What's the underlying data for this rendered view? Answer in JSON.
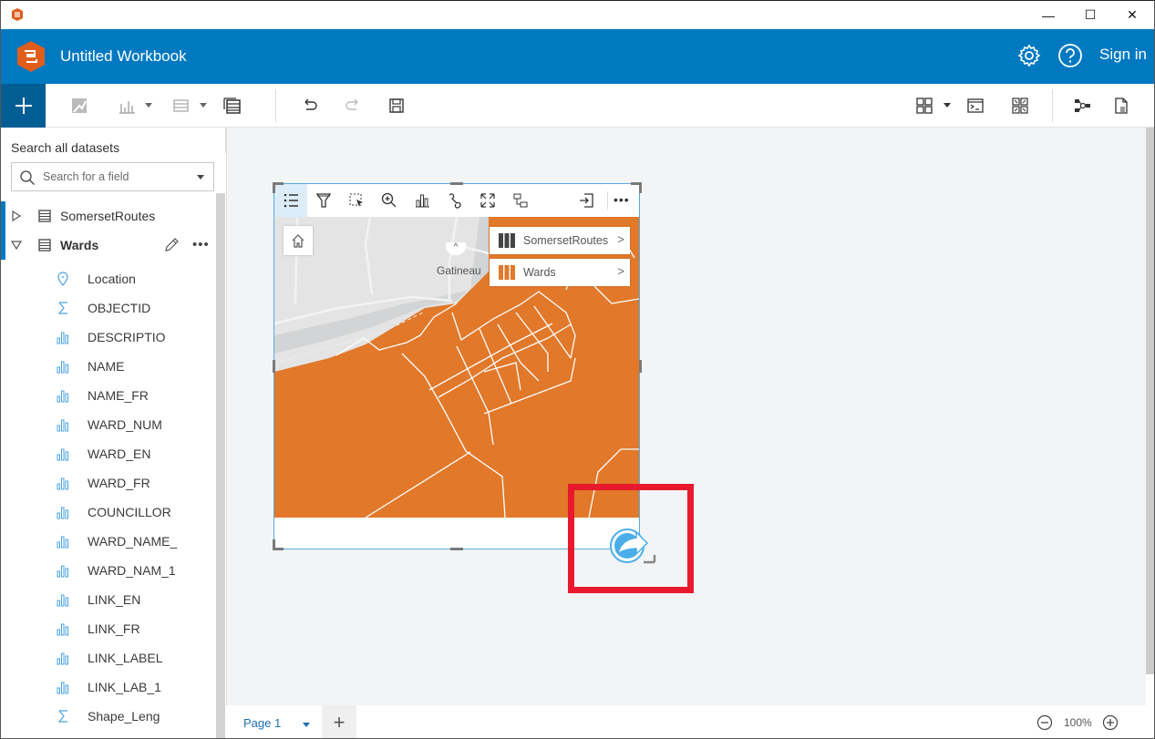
{
  "window": {
    "controls": {
      "minimize": "—",
      "maximize": "☐",
      "close": "✕"
    }
  },
  "header": {
    "title": "Untitled Workbook",
    "sign_in": "Sign in",
    "brand_color": "#0079c1",
    "icons": [
      "app-logo-icon",
      "gear-icon",
      "help-icon"
    ]
  },
  "toolbar": {
    "add_label": "+",
    "icons": [
      "map-icon",
      "chart-icon",
      "table-icon",
      "data-table-icon",
      "undo-icon",
      "redo-icon",
      "save-icon",
      "layout-icon",
      "console-icon",
      "qr-icon",
      "model-icon",
      "page-icon"
    ]
  },
  "sidebar": {
    "search_label": "Search all datasets",
    "search_placeholder": "Search for a field",
    "datasets": [
      {
        "name": "SomersetRoutes",
        "expanded": false
      },
      {
        "name": "Wards",
        "expanded": true
      }
    ],
    "fields": [
      {
        "name": "Location",
        "type": "location"
      },
      {
        "name": "OBJECTID",
        "type": "number"
      },
      {
        "name": "DESCRIPTIO",
        "type": "string"
      },
      {
        "name": "NAME",
        "type": "string"
      },
      {
        "name": "NAME_FR",
        "type": "string"
      },
      {
        "name": "WARD_NUM",
        "type": "string"
      },
      {
        "name": "WARD_EN",
        "type": "string"
      },
      {
        "name": "WARD_FR",
        "type": "string"
      },
      {
        "name": "COUNCILLOR",
        "type": "string"
      },
      {
        "name": "WARD_NAME_",
        "type": "string"
      },
      {
        "name": "WARD_NAM_1",
        "type": "string"
      },
      {
        "name": "LINK_EN",
        "type": "string"
      },
      {
        "name": "LINK_FR",
        "type": "string"
      },
      {
        "name": "LINK_LABEL",
        "type": "string"
      },
      {
        "name": "LINK_LAB_1",
        "type": "string"
      },
      {
        "name": "Shape_Leng",
        "type": "number"
      }
    ]
  },
  "map_card": {
    "toolbar_icons": [
      "legend-icon",
      "filter-icon",
      "select-icon",
      "zoom-icon",
      "chart-icon",
      "link-icon",
      "fullscreen-icon",
      "flip-icon",
      "export-icon",
      "more-icon"
    ],
    "place_label": "Gatineau",
    "legend": [
      {
        "name": "SomersetRoutes",
        "color": "#444444"
      },
      {
        "name": "Wards",
        "color": "#e1782a"
      }
    ],
    "fill_color": "#e1782a"
  },
  "bottombar": {
    "page_label": "Page 1",
    "add_page": "+",
    "zoom_level": "100%"
  }
}
